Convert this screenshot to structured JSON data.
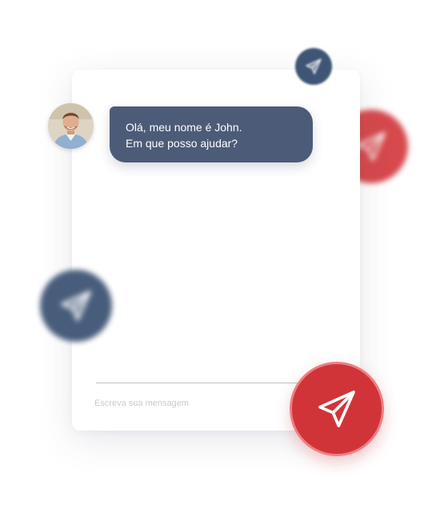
{
  "chat": {
    "message": {
      "line1": "Olá, meu nome é John.",
      "line2": "Em que posso ajudar?"
    },
    "input": {
      "placeholder": "Escreva sua mensagem",
      "value": ""
    },
    "avatar": {
      "icon": "agent-avatar"
    },
    "send_button": {
      "icon": "paper-plane-icon"
    }
  },
  "colors": {
    "message_bubble": "#4c5b78",
    "accent_red": "#d13438",
    "accent_red_ring": "#ee7f83",
    "navy": "#3f5575",
    "placeholder": "#c9cace"
  }
}
